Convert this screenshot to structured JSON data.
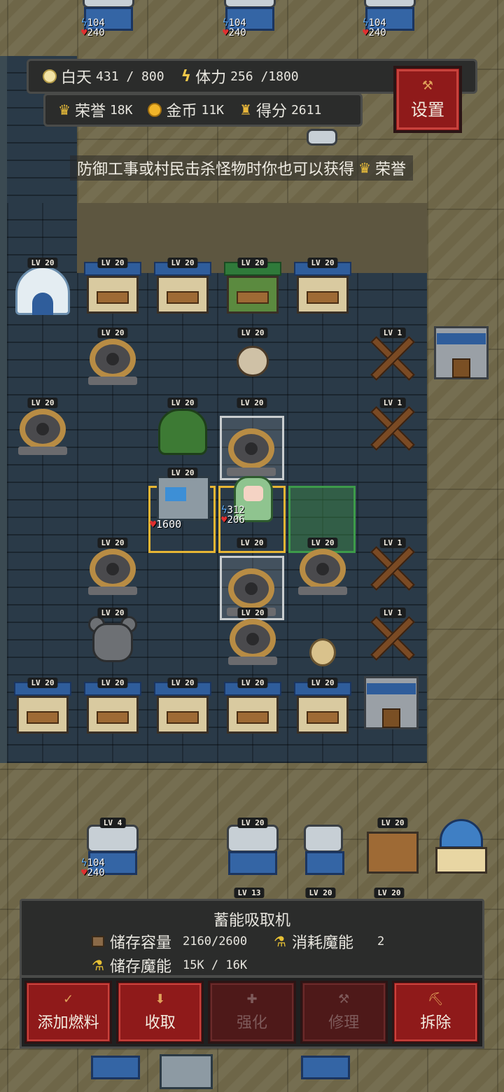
{
  "hud": {
    "day_label": "白天",
    "day_value": "431 / 800",
    "stamina_label": "体力",
    "stamina_value": "256 /1800",
    "honor_label": "荣誉",
    "honor_value": "18K",
    "gold_label": "金币",
    "gold_value": "11K",
    "score_label": "得分",
    "score_value": "2611"
  },
  "settings": {
    "label": "设置"
  },
  "tip": {
    "text": "防御工事或村民击杀怪物时你也可以获得",
    "reward": "荣誉"
  },
  "top_batteries": [
    {
      "energy": "104",
      "hp": "240"
    },
    {
      "energy": "104",
      "hp": "240"
    },
    {
      "energy": "104",
      "hp": "240"
    }
  ],
  "levels": {
    "lv20": "LV 20",
    "lv1": "LV 1",
    "lv4": "LV 4",
    "lv13": "LV 13"
  },
  "units": {
    "machine_hp": "1600",
    "girl_energy": "312",
    "girl_hp": "206",
    "battery_bottom_energy": "104",
    "battery_bottom_hp": "240"
  },
  "panel": {
    "title": "蓄能吸取机",
    "storage_label": "储存容量",
    "storage_value": "2160/2600",
    "consume_label": "消耗魔能",
    "consume_value": "2",
    "mana_label": "储存魔能",
    "mana_value": "15K / 16K"
  },
  "actions": [
    {
      "label": "添加燃料",
      "icon": "check-icon",
      "enabled": true
    },
    {
      "label": "收取",
      "icon": "arrow-down-icon",
      "enabled": true
    },
    {
      "label": "强化",
      "icon": "plus-icon",
      "enabled": false
    },
    {
      "label": "修理",
      "icon": "hammer-icon",
      "enabled": false
    },
    {
      "label": "拆除",
      "icon": "pickaxe-icon",
      "enabled": true
    }
  ],
  "colors": {
    "button_red": "#8f1a1a",
    "select_yellow": "#e7b634",
    "select_green": "#3d9b4a",
    "hp_red": "#e03030",
    "energy_blue": "#5fb0ff"
  }
}
